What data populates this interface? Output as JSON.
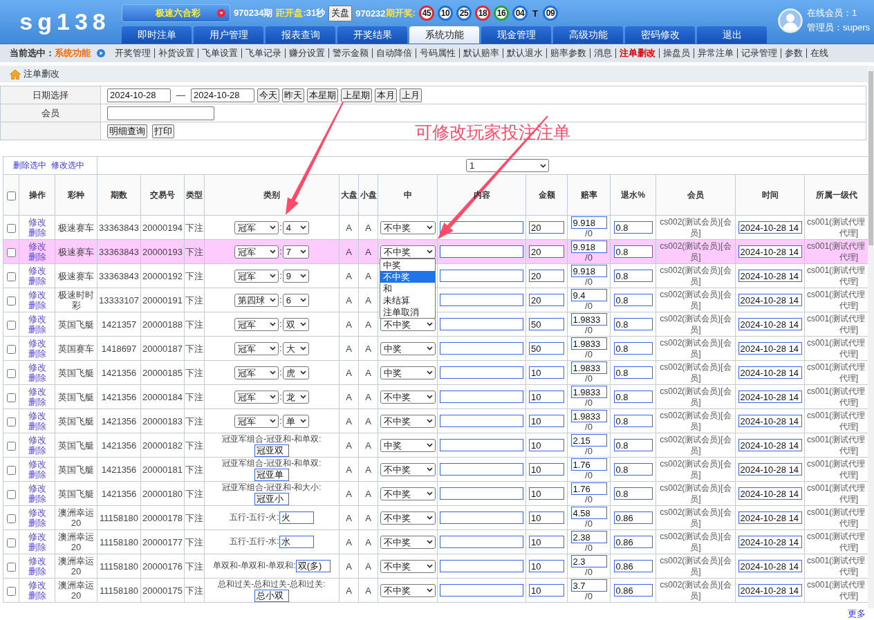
{
  "header": {
    "logo": "sg138",
    "lottery": "极速六合彩",
    "current_issue": "970234期",
    "countdown_label": "距开盘:",
    "countdown": "31秒",
    "close_button": "关盘",
    "last_issue": "970232",
    "last_issue_label": "期开奖:",
    "draw": [
      {
        "kind": "ball",
        "number": "45",
        "color": "#e3262f"
      },
      {
        "kind": "ball",
        "number": "10",
        "color": "#1f6fd6"
      },
      {
        "kind": "ball",
        "number": "25",
        "color": "#1f6fd6"
      },
      {
        "kind": "ball",
        "number": "18",
        "color": "#e3262f"
      },
      {
        "kind": "ball",
        "number": "16",
        "color": "#1fa83a"
      },
      {
        "kind": "ball",
        "number": "04",
        "color": "#1f6fd6"
      },
      {
        "kind": "mark",
        "text": "T"
      },
      {
        "kind": "ball",
        "number": "09",
        "color": "#1f6fd6"
      }
    ],
    "online": "在线会员：1",
    "admin": "管理员：supers"
  },
  "nav": [
    {
      "label": "即时注单",
      "selected": false
    },
    {
      "label": "用户管理",
      "selected": false
    },
    {
      "label": "报表查询",
      "selected": false
    },
    {
      "label": "开奖结果",
      "selected": false
    },
    {
      "label": "系统功能",
      "selected": true
    },
    {
      "label": "现金管理",
      "selected": false
    },
    {
      "label": "高级功能",
      "selected": false
    },
    {
      "label": "密码修改",
      "selected": false
    },
    {
      "label": "退出",
      "selected": false
    }
  ],
  "subnav": {
    "label": "当前选中：",
    "current": "系统功能",
    "items": [
      {
        "label": "开奖管理",
        "selected": false
      },
      {
        "label": "补货设置",
        "selected": false
      },
      {
        "label": "飞单设置",
        "selected": false
      },
      {
        "label": "飞单记录",
        "selected": false
      },
      {
        "label": "赚分设置",
        "selected": false
      },
      {
        "label": "警示金额",
        "selected": false
      },
      {
        "label": "自动降倍",
        "selected": false
      },
      {
        "label": "号码属性",
        "selected": false
      },
      {
        "label": "默认赔率",
        "selected": false
      },
      {
        "label": "默认退水",
        "selected": false
      },
      {
        "label": "赔率参数",
        "selected": false
      },
      {
        "label": "消息",
        "selected": false
      },
      {
        "label": "注单删改",
        "selected": true
      },
      {
        "label": "操盘员",
        "selected": false
      },
      {
        "label": "异常注单",
        "selected": false
      },
      {
        "label": "记录管理",
        "selected": false
      },
      {
        "label": "参数",
        "selected": false
      },
      {
        "label": "在线",
        "selected": false
      }
    ]
  },
  "page_title": "注单删改",
  "filter": {
    "date_label": "日期选择",
    "date_from": "2024-10-28",
    "date_separator": "—",
    "date_to": "2024-10-28",
    "quick_buttons": [
      "今天",
      "昨天",
      "本星期",
      "上星期",
      "本月",
      "上月"
    ],
    "member_label": "会员",
    "actions": [
      "明细查询",
      "打印"
    ]
  },
  "annotation": "可修改玩家投注注单",
  "table": {
    "bulk_actions": [
      "删除选中",
      "修改选中"
    ],
    "page": "1",
    "header_checked": false,
    "columns": [
      "操作",
      "彩种",
      "期数",
      "交易号",
      "类型",
      "类别",
      "大盘",
      "小盘",
      "中",
      "内容",
      "金额",
      "赔率",
      "退水%",
      "会员",
      "时间",
      "所属一级代"
    ],
    "rows": [
      {
        "checked": false,
        "highlighted": false,
        "actions": [
          "修改",
          "删除"
        ],
        "game": "极速赛车",
        "issue": "33363843",
        "ticket": "20000194",
        "type": "下注",
        "category": {
          "kind": "select",
          "play": "冠军",
          "sep": ":",
          "pick": "4"
        },
        "large_plate": "A",
        "small_plate": "A",
        "result": "不中奖",
        "amount": "20",
        "odds": "9.918",
        "odds_note": "/0",
        "rebate": "0.8",
        "member": "cs002(测试会员)[会员]",
        "time": "2024-10-28 14",
        "agent_lines": [
          "cs001(测试代理",
          "代理]"
        ]
      },
      {
        "checked": false,
        "highlighted": true,
        "actions": [
          "修改",
          "删除"
        ],
        "game": "极速赛车",
        "issue": "33363843",
        "ticket": "20000193",
        "type": "下注",
        "category": {
          "kind": "select",
          "play": "冠军",
          "sep": ":",
          "pick": "7"
        },
        "large_plate": "A",
        "small_plate": "A",
        "result": "不中奖",
        "result_menu": [
          {
            "label": "中奖",
            "selected": false
          },
          {
            "label": "不中奖",
            "selected": true
          },
          {
            "label": "和",
            "selected": false
          },
          {
            "label": "未结算",
            "selected": false
          },
          {
            "label": "注单取消",
            "selected": false
          }
        ],
        "amount": "20",
        "odds": "9.918",
        "odds_note": "/0",
        "rebate": "0.8",
        "member": "cs002(测试会员)[会员]",
        "time": "2024-10-28 14",
        "agent_lines": [
          "cs001(测试代理",
          "代理]"
        ]
      },
      {
        "checked": false,
        "highlighted": false,
        "actions": [
          "修改",
          "删除"
        ],
        "game": "极速赛车",
        "issue": "33363843",
        "ticket": "20000192",
        "type": "下注",
        "category": {
          "kind": "select",
          "play": "冠军",
          "sep": ":",
          "pick": "9"
        },
        "large_plate": "A",
        "small_plate": "A",
        "amount": "20",
        "odds": "9.918",
        "odds_note": "/0",
        "rebate": "0.8",
        "member": "cs002(测试会员)[会员]",
        "time": "2024-10-28 14",
        "agent_lines": [
          "cs001(测试代理",
          "代理]"
        ]
      },
      {
        "checked": false,
        "highlighted": false,
        "actions": [
          "修改",
          "删除"
        ],
        "game": "极速时时彩",
        "issue": "13333107",
        "ticket": "20000191",
        "type": "下注",
        "category": {
          "kind": "select",
          "play": "第四球",
          "sep": ":",
          "pick": "6"
        },
        "large_plate": "A",
        "small_plate": "A",
        "amount": "20",
        "odds": "9.4",
        "odds_note": "/0",
        "rebate": "0.8",
        "member": "cs002(测试会员)[会员]",
        "time": "2024-10-28 14",
        "agent_lines": [
          "cs001(测试代理",
          "代理]"
        ]
      },
      {
        "checked": false,
        "highlighted": false,
        "actions": [
          "修改",
          "删除"
        ],
        "game": "英国飞艇",
        "issue": "1421357",
        "ticket": "20000188",
        "type": "下注",
        "category": {
          "kind": "select",
          "play": "冠军",
          "sep": ":",
          "pick": "双"
        },
        "large_plate": "A",
        "small_plate": "A",
        "result": "不中奖",
        "amount": "50",
        "odds": "1.9833",
        "odds_note": "/0",
        "rebate": "0.8",
        "member": "cs002(测试会员)[会员]",
        "time": "2024-10-28 14",
        "agent_lines": [
          "cs001(测试代理",
          "代理]"
        ]
      },
      {
        "checked": false,
        "highlighted": false,
        "actions": [
          "修改",
          "删除"
        ],
        "game": "英国赛车",
        "issue": "1418697",
        "ticket": "20000187",
        "type": "下注",
        "category": {
          "kind": "select",
          "play": "冠军",
          "sep": ":",
          "pick": "大"
        },
        "large_plate": "A",
        "small_plate": "A",
        "result": "中奖",
        "amount": "50",
        "odds": "1.9833",
        "odds_note": "/0",
        "rebate": "0.8",
        "member": "cs002(测试会员)[会员]",
        "time": "2024-10-28 14",
        "agent_lines": [
          "cs001(测试代理",
          "代理]"
        ]
      },
      {
        "checked": false,
        "highlighted": false,
        "actions": [
          "修改",
          "删除"
        ],
        "game": "英国飞艇",
        "issue": "1421356",
        "ticket": "20000185",
        "type": "下注",
        "category": {
          "kind": "select",
          "play": "冠军",
          "sep": ":",
          "pick": "虎"
        },
        "large_plate": "A",
        "small_plate": "A",
        "result": "中奖",
        "amount": "10",
        "odds": "1.9833",
        "odds_note": "/0",
        "rebate": "0.8",
        "member": "cs002(测试会员)[会员]",
        "time": "2024-10-28 14",
        "agent_lines": [
          "cs001(测试代理",
          "代理]"
        ]
      },
      {
        "checked": false,
        "highlighted": false,
        "actions": [
          "修改",
          "删除"
        ],
        "game": "英国飞艇",
        "issue": "1421356",
        "ticket": "20000184",
        "type": "下注",
        "category": {
          "kind": "select",
          "play": "冠军",
          "sep": ":",
          "pick": "龙"
        },
        "large_plate": "A",
        "small_plate": "A",
        "result": "不中奖",
        "amount": "10",
        "odds": "1.9833",
        "odds_note": "/0",
        "rebate": "0.8",
        "member": "cs002(测试会员)[会员]",
        "time": "2024-10-28 14",
        "agent_lines": [
          "cs001(测试代理",
          "代理]"
        ]
      },
      {
        "checked": false,
        "highlighted": false,
        "actions": [
          "修改",
          "删除"
        ],
        "game": "英国飞艇",
        "issue": "1421356",
        "ticket": "20000183",
        "type": "下注",
        "category": {
          "kind": "select",
          "play": "冠军",
          "sep": ":",
          "pick": "单"
        },
        "large_plate": "A",
        "small_plate": "A",
        "result": "不中奖",
        "amount": "10",
        "odds": "1.9833",
        "odds_note": "/0",
        "rebate": "0.8",
        "member": "cs002(测试会员)[会员]",
        "time": "2024-10-28 14",
        "agent_lines": [
          "cs001(测试代理",
          "代理]"
        ]
      },
      {
        "checked": false,
        "highlighted": false,
        "actions": [
          "修改",
          "删除"
        ],
        "game": "英国飞艇",
        "issue": "1421356",
        "ticket": "20000182",
        "type": "下注",
        "category": {
          "kind": "text",
          "label": "冠亚军组合-冠亚和-和单双:",
          "value": "冠亚双"
        },
        "large_plate": "A",
        "small_plate": "A",
        "result": "中奖",
        "amount": "10",
        "odds": "2.15",
        "odds_note": "/0",
        "rebate": "0.8",
        "member": "cs002(测试会员)[会员]",
        "time": "2024-10-28 14",
        "agent_lines": [
          "cs001(测试代理",
          "代理]"
        ]
      },
      {
        "checked": false,
        "highlighted": false,
        "actions": [
          "修改",
          "删除"
        ],
        "game": "英国飞艇",
        "issue": "1421356",
        "ticket": "20000181",
        "type": "下注",
        "category": {
          "kind": "text",
          "label": "冠亚军组合-冠亚和-和单双:",
          "value": "冠亚单"
        },
        "large_plate": "A",
        "small_plate": "A",
        "result": "不中奖",
        "amount": "10",
        "odds": "1.76",
        "odds_note": "/0",
        "rebate": "0.8",
        "member": "cs002(测试会员)[会员]",
        "time": "2024-10-28 14",
        "agent_lines": [
          "cs001(测试代理",
          "代理]"
        ]
      },
      {
        "checked": false,
        "highlighted": false,
        "actions": [
          "修改",
          "删除"
        ],
        "game": "英国飞艇",
        "issue": "1421356",
        "ticket": "20000180",
        "type": "下注",
        "category": {
          "kind": "text",
          "label": "冠亚军组合-冠亚和-和大小:",
          "value": "冠亚小"
        },
        "large_plate": "A",
        "small_plate": "A",
        "result": "不中奖",
        "amount": "10",
        "odds": "1.76",
        "odds_note": "/0",
        "rebate": "0.8",
        "member": "cs002(测试会员)[会员]",
        "time": "2024-10-28 14",
        "agent_lines": [
          "cs001(测试代理",
          "代理]"
        ]
      },
      {
        "checked": false,
        "highlighted": false,
        "actions": [
          "修改",
          "删除"
        ],
        "game": "澳洲幸运20",
        "issue": "11158180",
        "ticket": "20000178",
        "type": "下注",
        "category": {
          "kind": "text",
          "label": "五行-五行-火:",
          "value": "火"
        },
        "large_plate": "A",
        "small_plate": "A",
        "result": "不中奖",
        "amount": "10",
        "odds": "4.58",
        "odds_note": "/0",
        "rebate": "0.86",
        "member": "cs002(测试会员)[会员]",
        "time": "2024-10-28 14",
        "agent_lines": [
          "cs001(测试代理",
          "代理]"
        ]
      },
      {
        "checked": false,
        "highlighted": false,
        "actions": [
          "修改",
          "删除"
        ],
        "game": "澳洲幸运20",
        "issue": "11158180",
        "ticket": "20000177",
        "type": "下注",
        "category": {
          "kind": "text",
          "label": "五行-五行-水:",
          "value": "水"
        },
        "large_plate": "A",
        "small_plate": "A",
        "result": "不中奖",
        "amount": "10",
        "odds": "2.38",
        "odds_note": "/0",
        "rebate": "0.86",
        "member": "cs002(测试会员)[会员]",
        "time": "2024-10-28 14",
        "agent_lines": [
          "cs001(测试代理",
          "代理]"
        ]
      },
      {
        "checked": false,
        "highlighted": false,
        "actions": [
          "修改",
          "删除"
        ],
        "game": "澳洲幸运20",
        "issue": "11158180",
        "ticket": "20000176",
        "type": "下注",
        "category": {
          "kind": "text",
          "label": "单双和-单双和-单双和:",
          "value": "双(多)"
        },
        "large_plate": "A",
        "small_plate": "A",
        "result": "不中奖",
        "amount": "10",
        "odds": "2.3",
        "odds_note": "/0",
        "rebate": "0.86",
        "member": "cs002(测试会员)[会员]",
        "time": "2024-10-28 14",
        "agent_lines": [
          "cs001(测试代理",
          "代理]"
        ]
      },
      {
        "checked": false,
        "highlighted": false,
        "actions": [
          "修改",
          "删除"
        ],
        "game": "澳洲幸运20",
        "issue": "11158180",
        "ticket": "20000175",
        "type": "下注",
        "category": {
          "kind": "text",
          "label": "总和过关-总和过关-总和过关:",
          "value": "总小双"
        },
        "large_plate": "A",
        "small_plate": "A",
        "result": "不中奖",
        "amount": "10",
        "odds": "3.7",
        "odds_note": "/0",
        "rebate": "0.86",
        "member": "cs002(测试会员)[会员]",
        "time": "2024-10-28 14",
        "agent_lines": [
          "cs001(测试代理",
          "代理]"
        ]
      }
    ]
  },
  "more_link": "更多"
}
